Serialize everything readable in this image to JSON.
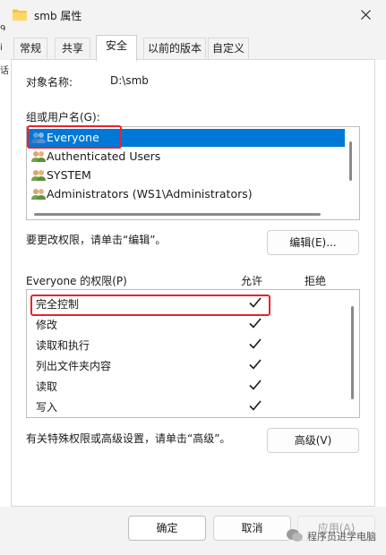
{
  "window": {
    "title": "smb 属性",
    "edge_glyph_1": "9",
    "edge_glyph_2": "i",
    "edge_glyph_3": "话"
  },
  "tabs": [
    {
      "label": "常规"
    },
    {
      "label": "共享"
    },
    {
      "label": "安全"
    },
    {
      "label": "以前的版本"
    },
    {
      "label": "自定义"
    }
  ],
  "active_tab": "安全",
  "object": {
    "label": "对象名称:",
    "value": "D:\\smb"
  },
  "groups": {
    "label": "组或用户名(G):",
    "items": [
      {
        "label": "Everyone",
        "selected": true
      },
      {
        "label": "Authenticated Users"
      },
      {
        "label": "SYSTEM"
      },
      {
        "label": "Administrators (WS1\\Administrators)"
      }
    ]
  },
  "change_permissions": {
    "text": "要更改权限，请单击“编辑”。",
    "edit_button": "编辑(E)..."
  },
  "permissions": {
    "title": "Everyone 的权限(P)",
    "allow_header": "允许",
    "deny_header": "拒绝",
    "rows": [
      {
        "label": "完全控制",
        "allow": true,
        "deny": false
      },
      {
        "label": "修改",
        "allow": true,
        "deny": false
      },
      {
        "label": "读取和执行",
        "allow": true,
        "deny": false
      },
      {
        "label": "列出文件夹内容",
        "allow": true,
        "deny": false
      },
      {
        "label": "读取",
        "allow": true,
        "deny": false
      },
      {
        "label": "写入",
        "allow": true,
        "deny": false
      }
    ]
  },
  "advanced": {
    "text": "有关特殊权限或高级设置，请单击“高级”。",
    "button": "高级(V)"
  },
  "footer": {
    "ok": "确定",
    "cancel": "取消",
    "apply": "应用(A)"
  },
  "watermark": {
    "text": "程序员进学电脑"
  },
  "colors": {
    "selection": "#0078d7",
    "highlight_box": "#e8232d",
    "chrome": "#f3f3f3"
  }
}
